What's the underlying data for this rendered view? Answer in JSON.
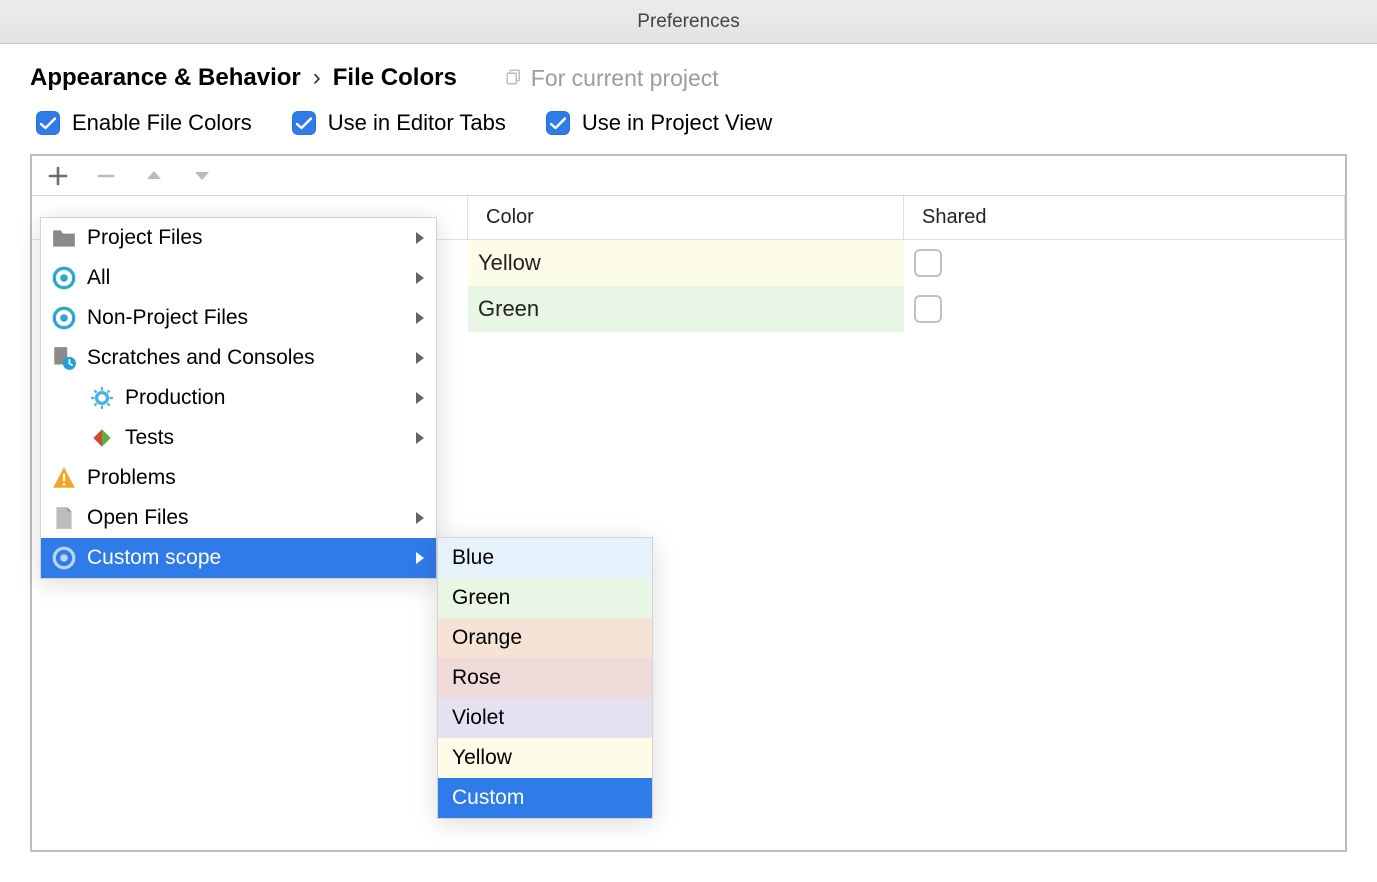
{
  "window": {
    "title": "Preferences"
  },
  "breadcrumb": {
    "parent": "Appearance & Behavior",
    "current": "File Colors",
    "scope_label": "For current project"
  },
  "checkboxes": {
    "enable": "Enable File Colors",
    "editor_tabs": "Use in Editor Tabs",
    "project_view": "Use in Project View"
  },
  "table": {
    "headers": {
      "color": "Color",
      "shared": "Shared"
    },
    "rows": [
      {
        "color_label": "Yellow"
      },
      {
        "color_label": "Green"
      }
    ]
  },
  "scope_menu": {
    "items": [
      {
        "label": "Project Files"
      },
      {
        "label": "All"
      },
      {
        "label": "Non-Project Files"
      },
      {
        "label": "Scratches and Consoles"
      },
      {
        "label": "Production"
      },
      {
        "label": "Tests"
      },
      {
        "label": "Problems"
      },
      {
        "label": "Open Files"
      },
      {
        "label": "Custom scope"
      }
    ]
  },
  "color_submenu": {
    "items": [
      {
        "label": "Blue",
        "bg": "#e6f2fb"
      },
      {
        "label": "Green",
        "bg": "#e9f6e6"
      },
      {
        "label": "Orange",
        "bg": "#f5e3d6"
      },
      {
        "label": "Rose",
        "bg": "#eedbda"
      },
      {
        "label": "Violet",
        "bg": "#e5e1f1"
      },
      {
        "label": "Yellow",
        "bg": "#fcfce7"
      },
      {
        "label": "Custom",
        "bg": "",
        "selected": true
      }
    ]
  }
}
